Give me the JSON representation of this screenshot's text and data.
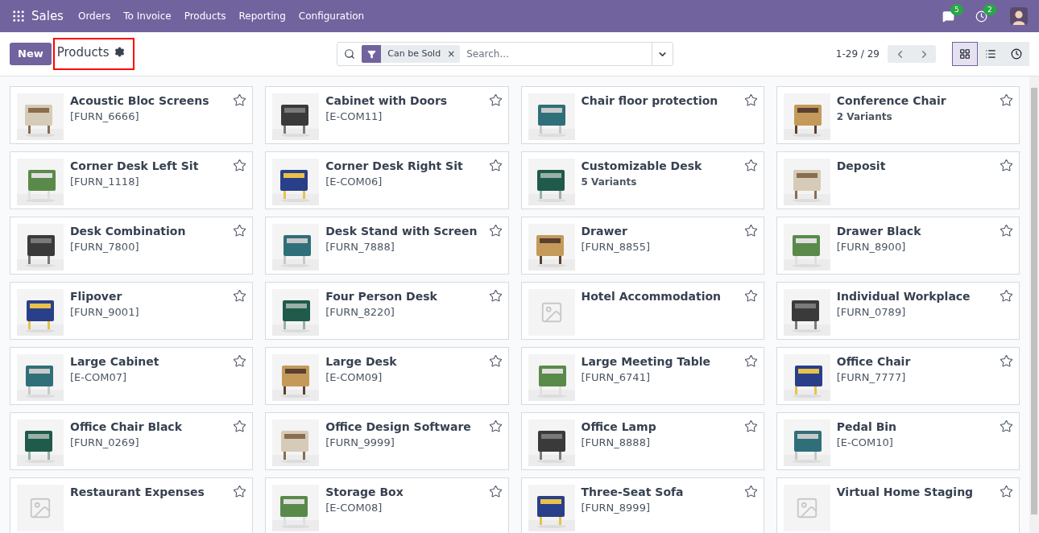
{
  "navbar": {
    "app": "Sales",
    "menu": [
      "Orders",
      "To Invoice",
      "Products",
      "Reporting",
      "Configuration"
    ],
    "messages_count": "5",
    "activities_count": "2"
  },
  "control_panel": {
    "new_button": "New",
    "title": "Products",
    "title_highlighted": true,
    "filter": "Can be Sold",
    "filter_remove": "×",
    "search": {
      "placeholder": "Search..."
    },
    "pager": "1-29 / 29",
    "views": [
      {
        "kind": "kanban",
        "selected": true
      },
      {
        "kind": "list",
        "selected": false
      },
      {
        "kind": "activity",
        "selected": false
      }
    ]
  },
  "products": [
    {
      "name": "Acoustic Bloc Screens",
      "detail": "[FURN_6666]",
      "variants": false,
      "kind": "picture",
      "starred": false
    },
    {
      "name": "Cabinet with Doors",
      "detail": "[E-COM11]",
      "variants": false,
      "kind": "picture",
      "starred": false
    },
    {
      "name": "Chair floor protection",
      "kind": "picture",
      "starred": false
    },
    {
      "name": "Conference Chair",
      "detail": "2 Variants",
      "variants": true,
      "kind": "picture",
      "starred": false
    },
    {
      "name": "Corner Desk Left Sit",
      "detail": "[FURN_1118]",
      "variants": false,
      "kind": "picture",
      "starred": false
    },
    {
      "name": "Corner Desk Right Sit",
      "detail": "[E-COM06]",
      "variants": false,
      "kind": "picture",
      "starred": false
    },
    {
      "name": "Customizable Desk",
      "detail": "5 Variants",
      "variants": true,
      "kind": "picture",
      "starred": false
    },
    {
      "name": "Deposit",
      "kind": "picture",
      "starred": false
    },
    {
      "name": "Desk Combination",
      "detail": "[FURN_7800]",
      "variants": false,
      "kind": "picture",
      "starred": false
    },
    {
      "name": "Desk Stand with Screen",
      "detail": "[FURN_7888]",
      "variants": false,
      "kind": "picture",
      "starred": false
    },
    {
      "name": "Drawer",
      "detail": "[FURN_8855]",
      "variants": false,
      "kind": "picture",
      "starred": false
    },
    {
      "name": "Drawer Black",
      "detail": "[FURN_8900]",
      "variants": false,
      "kind": "picture",
      "starred": false
    },
    {
      "name": "Flipover",
      "detail": "[FURN_9001]",
      "variants": false,
      "kind": "picture",
      "starred": false
    },
    {
      "name": "Four Person Desk",
      "detail": "[FURN_8220]",
      "variants": false,
      "kind": "picture",
      "starred": false
    },
    {
      "name": "Hotel Accommodation",
      "kind": "placeholder",
      "starred": false
    },
    {
      "name": "Individual Workplace",
      "detail": "[FURN_0789]",
      "variants": false,
      "kind": "picture",
      "starred": false
    },
    {
      "name": "Large Cabinet",
      "detail": "[E-COM07]",
      "variants": false,
      "kind": "picture",
      "starred": false
    },
    {
      "name": "Large Desk",
      "detail": "[E-COM09]",
      "variants": false,
      "kind": "picture",
      "starred": false
    },
    {
      "name": "Large Meeting Table",
      "detail": "[FURN_6741]",
      "variants": false,
      "kind": "picture",
      "starred": false
    },
    {
      "name": "Office Chair",
      "detail": "[FURN_7777]",
      "variants": false,
      "kind": "picture",
      "starred": false
    },
    {
      "name": "Office Chair Black",
      "detail": "[FURN_0269]",
      "variants": false,
      "kind": "picture",
      "starred": false
    },
    {
      "name": "Office Design Software",
      "detail": "[FURN_9999]",
      "variants": false,
      "kind": "picture",
      "starred": false
    },
    {
      "name": "Office Lamp",
      "detail": "[FURN_8888]",
      "variants": false,
      "kind": "picture",
      "starred": false
    },
    {
      "name": "Pedal Bin",
      "detail": "[E-COM10]",
      "variants": false,
      "kind": "picture",
      "starred": false
    },
    {
      "name": "Restaurant Expenses",
      "kind": "placeholder",
      "starred": false
    },
    {
      "name": "Storage Box",
      "detail": "[E-COM08]",
      "variants": false,
      "kind": "picture",
      "starred": false
    },
    {
      "name": "Three-Seat Sofa",
      "detail": "[FURN_8999]",
      "variants": false,
      "kind": "picture",
      "starred": false
    },
    {
      "name": "Virtual Home Staging",
      "kind": "placeholder",
      "starred": false
    }
  ]
}
